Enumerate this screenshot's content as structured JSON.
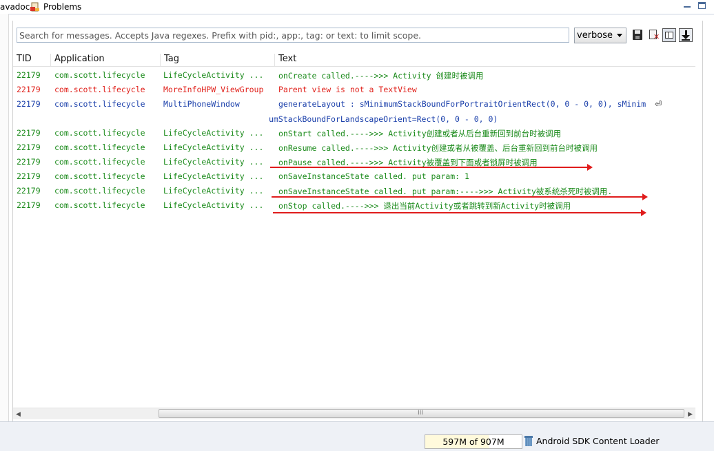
{
  "tabs": [
    {
      "label": "avadoc"
    },
    {
      "label": "Problems",
      "icon": "problems-icon"
    }
  ],
  "window_controls": {
    "minimize_icon": "minimize-icon",
    "maximize_icon": "maximize-icon"
  },
  "toolbar": {
    "search_placeholder": "Search for messages. Accepts Java regexes. Prefix with pid:, app:, tag: or text: to limit scope.",
    "log_level": "verbose",
    "icons": [
      "save-icon",
      "clear-log-icon",
      "show-saved-filters-icon",
      "scroll-lock-icon"
    ]
  },
  "table": {
    "columns": [
      "TID",
      "Application",
      "Tag",
      "Text"
    ],
    "rows": [
      {
        "tid": "22179",
        "app": "com.scott.lifecycle",
        "tag": "LifeCycleActivity ...",
        "text": "onCreate called.---->>> Activity 创建时被调用",
        "color": "#1a8a1a"
      },
      {
        "tid": "22179",
        "app": "com.scott.lifecycle",
        "tag": "MoreInfoHPW_ViewGroup",
        "text": "Parent view is not a TextView",
        "color": "#e0201a"
      },
      {
        "tid": "22179",
        "app": "com.scott.lifecycle",
        "tag": "MultiPhoneWindow",
        "text": "generateLayout : sMinimumStackBoundForPortraitOrientRect(0, 0 - 0, 0), sMinim",
        "text_wrap": "umStackBoundForLandscapeOrient=Rect(0, 0 - 0, 0)",
        "color": "#1a3faa"
      },
      {
        "tid": "22179",
        "app": "com.scott.lifecycle",
        "tag": "LifeCycleActivity ...",
        "text": "onStart called.---->>> Activity创建或者从后台重新回到前台时被调用",
        "color": "#1a8a1a"
      },
      {
        "tid": "22179",
        "app": "com.scott.lifecycle",
        "tag": "LifeCycleActivity ...",
        "text": "onResume called.---->>> Activity创建或者从被覆盖、后台重新回到前台时被调用",
        "color": "#1a8a1a"
      },
      {
        "tid": "22179",
        "app": "com.scott.lifecycle",
        "tag": "LifeCycleActivity ...",
        "text": "onPause called.---->>> Activity被覆盖到下面或者锁屏时被调用",
        "color": "#1a8a1a"
      },
      {
        "tid": "22179",
        "app": "com.scott.lifecycle",
        "tag": "LifeCycleActivity ...",
        "text": "onSaveInstanceState called. put param: 1",
        "color": "#1a8a1a"
      },
      {
        "tid": "22179",
        "app": "com.scott.lifecycle",
        "tag": "LifeCycleActivity ...",
        "text": "onSaveInstanceState called. put param:---->>> Activity被系统杀死时被调用.",
        "color": "#1a8a1a"
      },
      {
        "tid": "22179",
        "app": "com.scott.lifecycle",
        "tag": "LifeCycleActivity ...",
        "text": "onStop called.---->>> 退出当前Activity或者跳转到新Activity时被调用",
        "color": "#1a8a1a"
      }
    ],
    "wrap_icon": "wrap-arrow-icon"
  },
  "annotation_color": "#e01c1c",
  "scrollbar": {
    "grip": "III",
    "left_arrow": "◀",
    "right_arrow": "▶"
  },
  "status": {
    "heap": "597M of 907M",
    "heap_used_fraction": 0.66,
    "loader_label": "Android SDK Content Loader",
    "loader_icon": "trash-icon"
  }
}
